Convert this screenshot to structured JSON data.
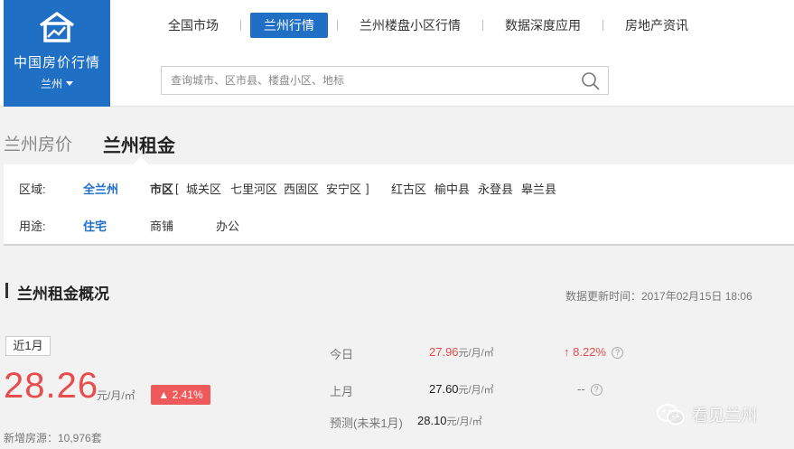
{
  "logo": {
    "title": "中国房价行情",
    "city": "兰州"
  },
  "nav": {
    "items": [
      {
        "label": "全国市场",
        "active": false
      },
      {
        "label": "兰州行情",
        "active": true
      },
      {
        "label": "兰州楼盘小区行情",
        "active": false
      },
      {
        "label": "数据深度应用",
        "active": false
      },
      {
        "label": "房地产资讯",
        "active": false
      }
    ]
  },
  "search": {
    "placeholder": "查询城市、区市县、楼盘小区、地标"
  },
  "page_tabs": [
    {
      "label": "兰州房价"
    },
    {
      "label": "兰州租金"
    }
  ],
  "filter": {
    "region_label": "区域:",
    "region_all": "全兰州",
    "city_label": "市区",
    "city_open_bracket": "[",
    "city_close_bracket": "]",
    "districts": [
      "城关区",
      "七里河区",
      "西固区",
      "安宁区"
    ],
    "counties": [
      "红古区",
      "榆中县",
      "永登县",
      "皋兰县"
    ],
    "usage_label": "用途:",
    "usages": [
      "住宅",
      "商铺",
      "办公"
    ]
  },
  "overview": {
    "title": "兰州租金概况",
    "updated": "数据更新时间：2017年02月15日 18:06",
    "period": "近1月",
    "price": "28.26",
    "unit": "元/月/㎡",
    "change": "2.41%",
    "new_listings": "新增房源：10,976套",
    "today_label": "今日",
    "today_value": "27.96",
    "today_change": "8.22%",
    "last_month_label": "上月",
    "last_month_value": "27.60",
    "last_month_change": "--",
    "forecast_label": "预测(未来1月)",
    "forecast_value": "28.10"
  },
  "watermark": {
    "text": "看见兰州"
  },
  "colors": {
    "brand": "#1f6fc5",
    "up": "#e84c4c"
  }
}
